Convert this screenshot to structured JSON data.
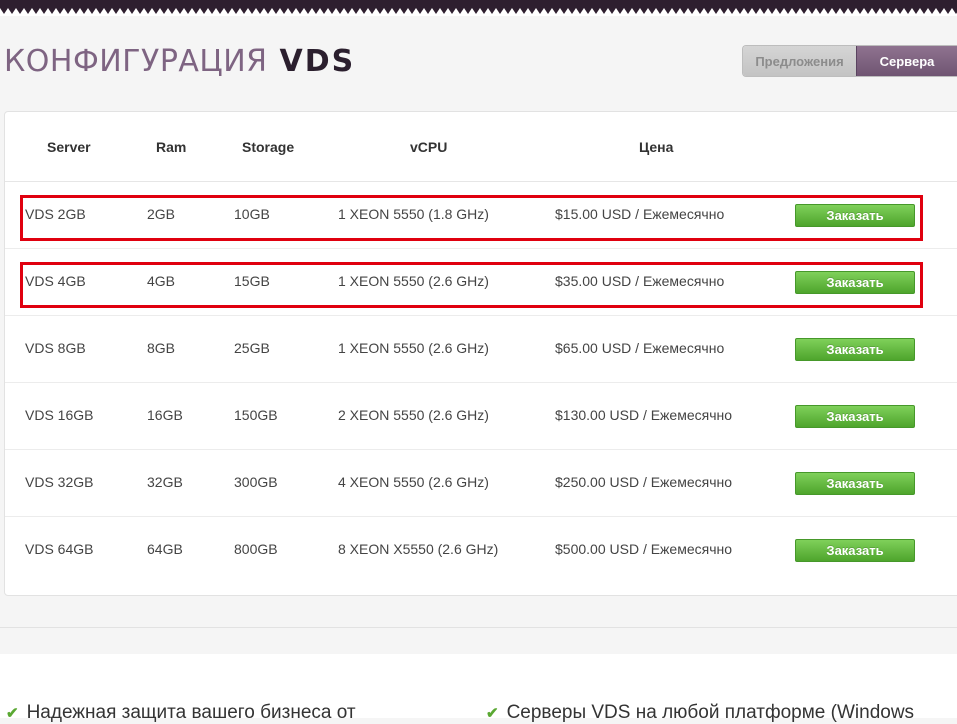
{
  "header": {
    "title_main": "КОНФИГУРАЦИЯ",
    "title_accent": "VDS",
    "tabs": [
      {
        "label": "Предложения",
        "active": false
      },
      {
        "label": "Сервера",
        "active": true
      }
    ]
  },
  "table": {
    "columns": [
      "Server",
      "Ram",
      "Storage",
      "vCPU",
      "Цена"
    ],
    "order_label": "Заказать",
    "rows": [
      {
        "server": "VDS 2GB",
        "ram": "2GB",
        "storage": "10GB",
        "vcpu": "1 XEON 5550 (1.8 GHz)",
        "price": "$15.00 USD / Ежемесячно",
        "highlighted": true
      },
      {
        "server": "VDS 4GB",
        "ram": "4GB",
        "storage": "15GB",
        "vcpu": "1 XEON 5550 (2.6 GHz)",
        "price": "$35.00 USD / Ежемесячно",
        "highlighted": true
      },
      {
        "server": "VDS 8GB",
        "ram": "8GB",
        "storage": "25GB",
        "vcpu": "1 XEON 5550 (2.6 GHz)",
        "price": "$65.00 USD / Ежемесячно",
        "highlighted": false
      },
      {
        "server": "VDS 16GB",
        "ram": "16GB",
        "storage": "150GB",
        "vcpu": "2 XEON 5550 (2.6 GHz)",
        "price": "$130.00 USD / Ежемесячно",
        "highlighted": false
      },
      {
        "server": "VDS 32GB",
        "ram": "32GB",
        "storage": "300GB",
        "vcpu": "4 XEON 5550 (2.6 GHz)",
        "price": "$250.00 USD / Ежемесячно",
        "highlighted": false
      },
      {
        "server": "VDS 64GB",
        "ram": "64GB",
        "storage": "800GB",
        "vcpu": "8 XEON X5550 (2.6 GHz)",
        "price": "$500.00 USD / Ежемесячно",
        "highlighted": false
      }
    ]
  },
  "features": [
    "Надежная защита вашего бизнеса от",
    "Серверы VDS на любой платформе (Windows"
  ],
  "colors": {
    "accent_purple": "#7e6482",
    "order_green": "#5cb336",
    "highlight_red": "#e0000f"
  }
}
